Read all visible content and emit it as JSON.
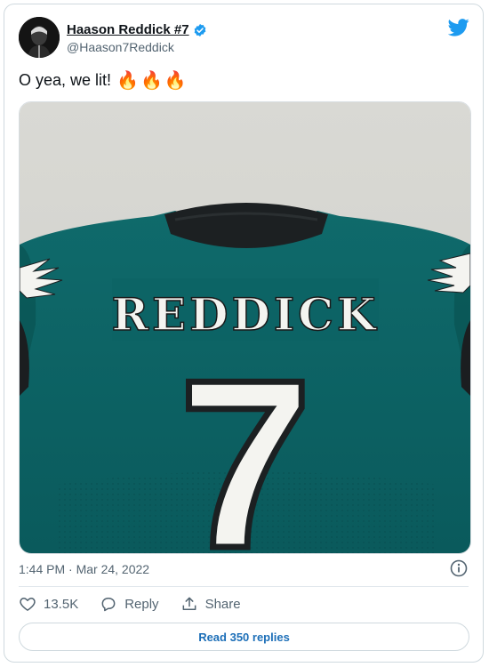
{
  "author": {
    "display_name": "Haason Reddick #7",
    "handle": "@Haason7Reddick",
    "verified": true,
    "avatar_icon": "avatar-portrait-icon"
  },
  "tweet": {
    "text": "O yea, we lit!",
    "emojis": [
      "🔥",
      "🔥",
      "🔥"
    ],
    "timestamp": "1:44 PM · Mar 24, 2022"
  },
  "media": {
    "jersey_name": "REDDICK",
    "jersey_number": "7",
    "jersey_color": "#0b5f61",
    "collar_color": "#1c2022"
  },
  "actions": {
    "like_count": "13.5K",
    "reply_label": "Reply",
    "share_label": "Share"
  },
  "read_replies_label": "Read 350 replies",
  "colors": {
    "brand": "#1d9bf0",
    "secondary_text": "#536471",
    "border": "#cfd9de"
  }
}
